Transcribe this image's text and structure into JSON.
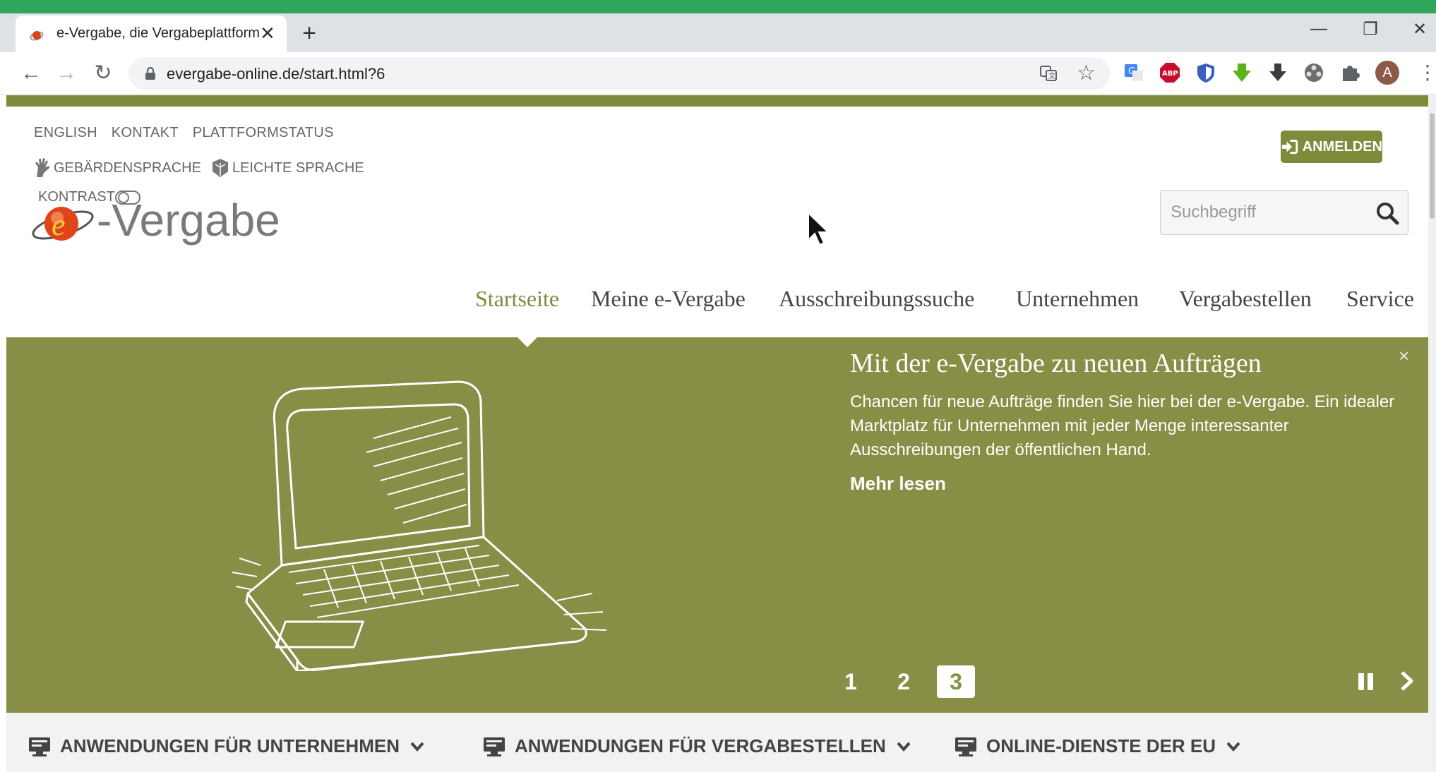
{
  "browser": {
    "tab_title": "e-Vergabe, die Vergabeplattform",
    "tab_close": "✕",
    "new_tab": "+",
    "url": "evergabe-online.de/start.html?6",
    "window_controls": {
      "minimize": "—",
      "restore": "❐",
      "close": "✕"
    },
    "profile_initial": "A",
    "extensions": [
      "google-translate-icon",
      "adblock-plus-icon",
      "shield-icon",
      "green-download-icon",
      "download-icon",
      "film-icon",
      "puzzle-icon"
    ]
  },
  "header": {
    "meta_links": [
      "ENGLISH",
      "KONTAKT",
      "PLATTFORMSTATUS"
    ],
    "accessibility_links": [
      "GEBÄRDENSPRACHE",
      "LEICHTE SPRACHE"
    ],
    "contrast_label": "KONTRAST",
    "logo_text": "-Vergabe",
    "login_label": "ANMELDEN",
    "search_placeholder": "Suchbegriff"
  },
  "nav": {
    "items": [
      "Startseite",
      "Meine e-Vergabe",
      "Ausschreibungssuche",
      "Unternehmen",
      "Vergabestellen",
      "Service"
    ],
    "active": "Startseite"
  },
  "hero": {
    "title": "Mit der e-Vergabe zu neuen Aufträgen",
    "text": "Chancen für neue Aufträge finden Sie hier bei der e-Vergabe. Ein idealer Marktplatz für Unternehmen mit jeder Menge interessanter Ausschreibungen der öffentlichen Hand.",
    "more_label": "Mehr lesen",
    "close_label": "×",
    "pages": [
      "1",
      "2",
      "3"
    ],
    "active_page": "3",
    "background_color": "#888e45"
  },
  "bottom_bar": {
    "items": [
      "ANWENDUNGEN FÜR UNTERNEHMEN",
      "ANWENDUNGEN FÜR VERGABESTELLEN",
      "ONLINE-DIENSTE DER EU"
    ]
  },
  "colors": {
    "brand_olive": "#7f8a3b",
    "hero_olive": "#888e45",
    "top_strip_green": "#2fa65a"
  }
}
